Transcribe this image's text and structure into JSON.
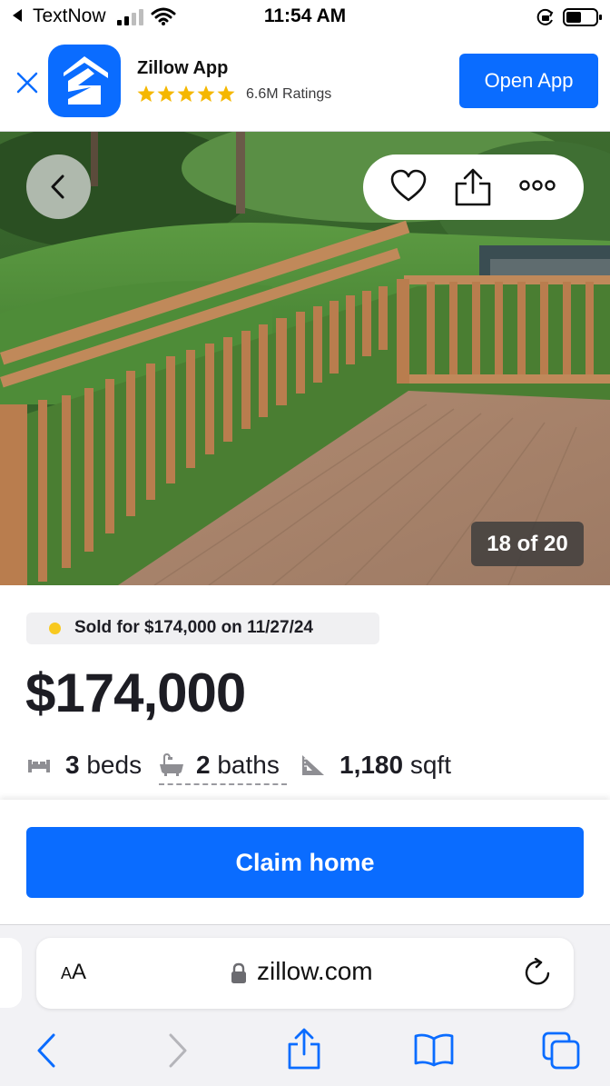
{
  "status_bar": {
    "carrier": "TextNow",
    "time": "11:54 AM"
  },
  "app_banner": {
    "app_name": "Zillow App",
    "rating_stars": 5,
    "ratings_text": "6.6M Ratings",
    "open_button": "Open App",
    "accent_color": "#0a6cff"
  },
  "photo": {
    "counter": "18 of 20",
    "current_index": 18,
    "total": 20,
    "icons": [
      "chevron-left-icon",
      "heart-icon",
      "share-icon",
      "more-icon"
    ]
  },
  "listing": {
    "status_badge": "Sold for $174,000 on 11/27/24",
    "status_dot_color": "#f8c920",
    "price": "$174,000",
    "beds_num": "3",
    "beds_label": "beds",
    "baths_num": "2",
    "baths_label": "baths",
    "sqft_num": "1,180",
    "sqft_label": "sqft"
  },
  "cta": {
    "claim_label": "Claim home"
  },
  "safari": {
    "aa_small": "A",
    "aa_large": "A",
    "url": "zillow.com",
    "toolbar": [
      "back-icon",
      "forward-icon",
      "share-icon",
      "bookmarks-icon",
      "tabs-icon"
    ]
  }
}
